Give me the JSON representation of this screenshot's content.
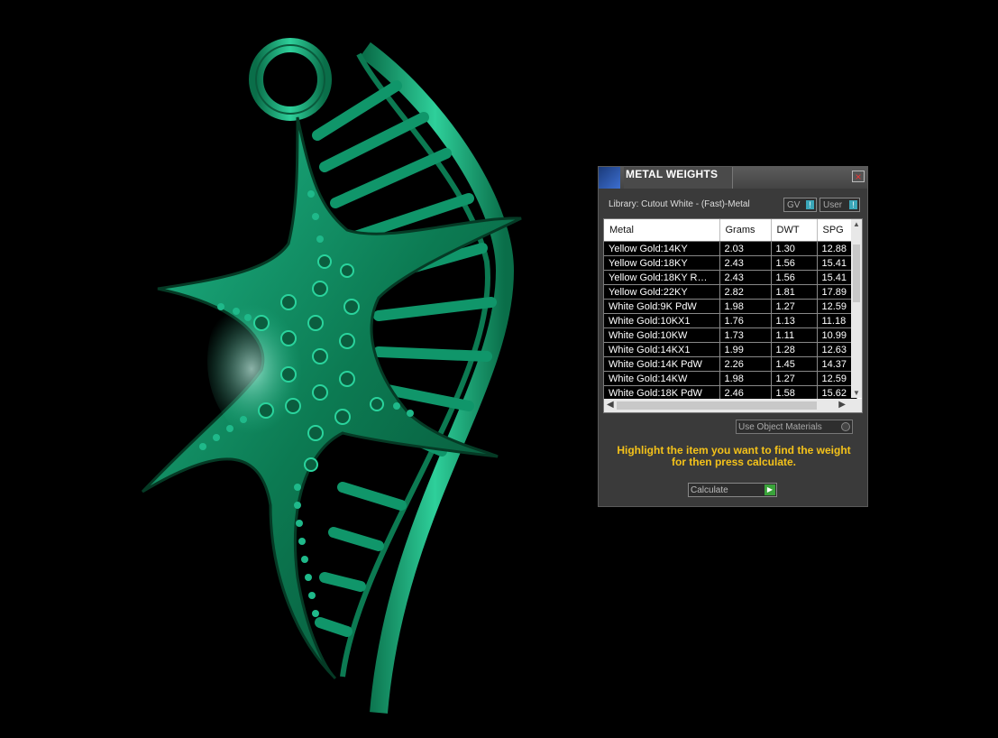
{
  "panel": {
    "title": "METAL WEIGHTS",
    "library_label": "Library: Cutout White - (Fast)-Metal",
    "toggles": {
      "gv": "GV",
      "user": "User"
    },
    "columns": [
      "Metal",
      "Grams",
      "DWT",
      "SPG"
    ],
    "rows": [
      [
        "Yellow Gold:14KY",
        "2.03",
        "1.30",
        "12.88"
      ],
      [
        "Yellow Gold:18KY",
        "2.43",
        "1.56",
        "15.41"
      ],
      [
        "Yellow Gold:18KY R…",
        "2.43",
        "1.56",
        "15.41"
      ],
      [
        "Yellow Gold:22KY",
        "2.82",
        "1.81",
        "17.89"
      ],
      [
        "White Gold:9K PdW",
        "1.98",
        "1.27",
        "12.59"
      ],
      [
        "White Gold:10KX1",
        "1.76",
        "1.13",
        "11.18"
      ],
      [
        "White Gold:10KW",
        "1.73",
        "1.11",
        "10.99"
      ],
      [
        "White Gold:14KX1",
        "1.99",
        "1.28",
        "12.63"
      ],
      [
        "White Gold:14K PdW",
        "2.26",
        "1.45",
        "14.37"
      ],
      [
        "White Gold:14KW",
        "1.98",
        "1.27",
        "12.59"
      ],
      [
        "White Gold:18K PdW",
        "2.46",
        "1.58",
        "15.62"
      ]
    ],
    "use_object_materials": "Use Object Materials",
    "instructions_line1": "Highlight the item you want to find the weight",
    "instructions_line2": "for then press calculate.",
    "calculate_label": "Calculate",
    "accent_color": "#f4c21a",
    "model_color": "#0f8a5f"
  }
}
